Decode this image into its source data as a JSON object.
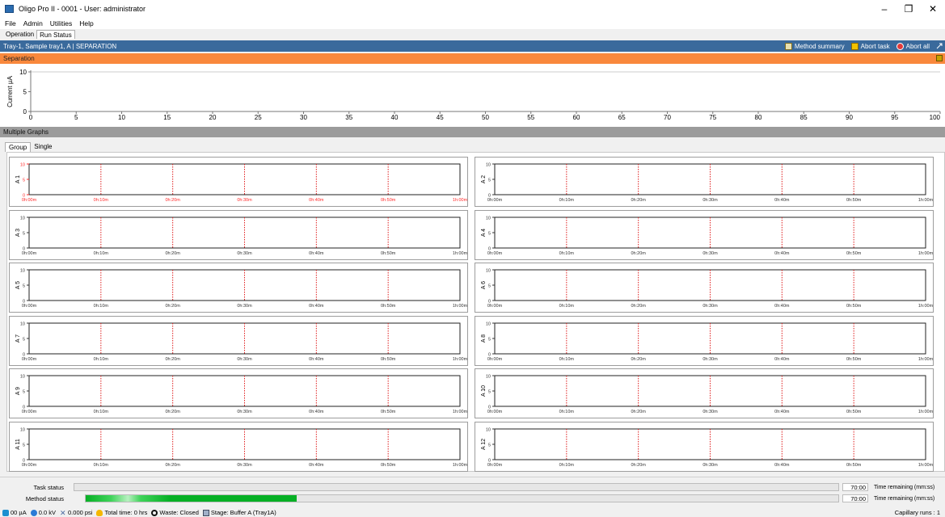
{
  "window": {
    "title": "Oligo Pro II - 0001 - User: administrator",
    "minimize": "–",
    "restore": "❐",
    "close": "✕"
  },
  "menu": [
    "File",
    "Admin",
    "Utilities",
    "Help"
  ],
  "tabs": {
    "operation": "Operation",
    "run_status": "Run Status"
  },
  "header": {
    "left": "Tray-1, Sample tray1, A  | SEPARATION",
    "method_summary": "Method summary",
    "abort_task": "Abort task",
    "abort_all": "Abort all",
    "colors": {
      "bar": "#3a6a9c"
    }
  },
  "separation": {
    "title": "Separation",
    "ylabel": "Current µA",
    "yticks": [
      "10",
      "5",
      "0"
    ],
    "xticks": [
      "0",
      "5",
      "10",
      "15",
      "20",
      "25",
      "30",
      "35",
      "40",
      "45",
      "50",
      "55",
      "60",
      "65",
      "70",
      "75",
      "80",
      "85",
      "90",
      "95",
      "100"
    ],
    "colors": {
      "bar": "#f9883c"
    }
  },
  "multiple_graphs": {
    "title": "Multiple Graphs",
    "subtabs": {
      "group": "Group",
      "single": "Single"
    },
    "yticks": [
      "10",
      "5",
      "0"
    ],
    "xticks": [
      "0h:00m",
      "0h:10m",
      "0h:20m",
      "0h:30m",
      "0h:40m",
      "0h:50m",
      "1h:00m"
    ],
    "highlight_color": "#ff2a2a",
    "graphs": [
      {
        "label": "A 1",
        "highlight": true
      },
      {
        "label": "A 2",
        "highlight": false
      },
      {
        "label": "A 3",
        "highlight": false
      },
      {
        "label": "A 4",
        "highlight": false
      },
      {
        "label": "A 5",
        "highlight": false
      },
      {
        "label": "A 6",
        "highlight": false
      },
      {
        "label": "A 7",
        "highlight": false
      },
      {
        "label": "A 8",
        "highlight": false
      },
      {
        "label": "A 9",
        "highlight": false
      },
      {
        "label": "A 10",
        "highlight": false
      },
      {
        "label": "A 11",
        "highlight": false
      },
      {
        "label": "A 12",
        "highlight": false
      }
    ]
  },
  "status": {
    "task_label": "Task status",
    "task_progress": 0.0,
    "task_time": "70:00",
    "method_label": "Method status",
    "method_progress": 0.28,
    "method_time": "70:00",
    "time_label": "Time remaining (mm:ss)"
  },
  "statusbar": {
    "current": "00 µA",
    "voltage": "0.0 kV",
    "pressure": "0.000 psi",
    "total_time": "Total time: 0 hrs",
    "waste": "Waste: Closed",
    "stage": "Stage: Buffer A (Tray1A)",
    "capillary": "Capillary runs : 1"
  }
}
